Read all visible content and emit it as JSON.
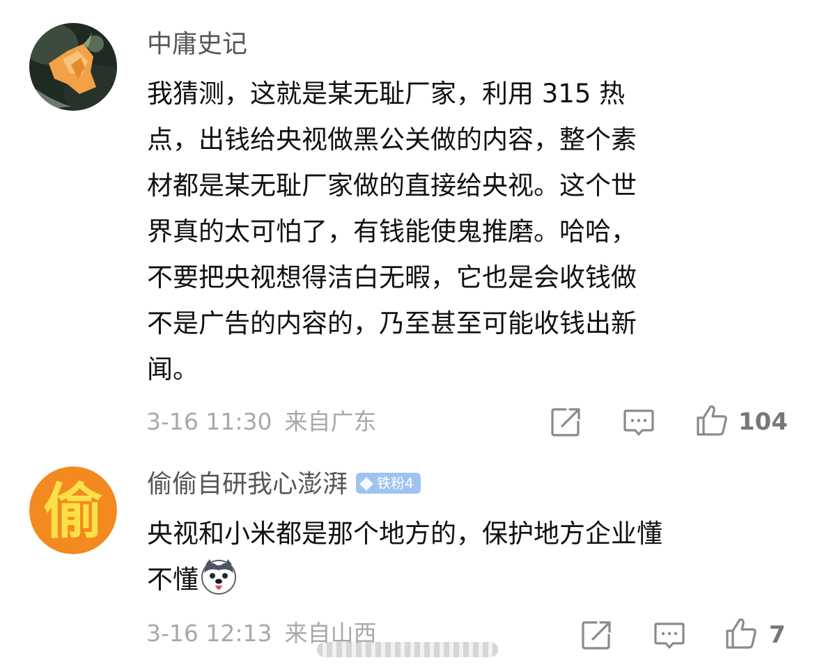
{
  "comments": [
    {
      "username": "中庸史记",
      "content_lines": [
        "我猜测，这就是某无耻厂家，利用 315 热",
        "点，出钱给央视做黑公关做的内容，整个素",
        "材都是某无耻厂家做的直接给央视。这个世",
        "界真的太可怕了，有钱能使鬼推磨。哈哈，",
        "不要把央视想得洁白无暇，它也是会收钱做",
        "不是广告的内容的，乃至甚至可能收钱出新",
        "闻。"
      ],
      "time": "3-16 11:30",
      "location": "来自广东",
      "likes": "104",
      "avatar_icon": "orange-flower-photo-avatar"
    },
    {
      "username": "偷偷自研我心澎湃",
      "badge": "铁粉4",
      "content_lines": [
        "央视和小米都是那个地方的，保护地方企业懂",
        "不懂"
      ],
      "emoji_icon": "husky-dog-emoji",
      "time": "3-16 12:13",
      "location": "来自山西",
      "likes": "7",
      "avatar_icon": "tou-character-avatar",
      "avatar_char": "偷"
    }
  ],
  "icons": {
    "share": "share-icon",
    "reply": "comment-icon",
    "like": "thumbs-up-icon"
  },
  "colors": {
    "text": "#111111",
    "username": "#555555",
    "meta": "#a8a8a8",
    "icon": "#8a8a8a",
    "badge": "#9ec3f0",
    "avatar2_bg": "#f28a1f",
    "avatar2_fg": "#fde047"
  }
}
